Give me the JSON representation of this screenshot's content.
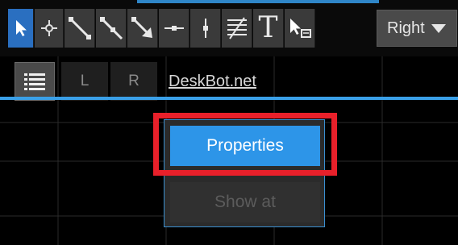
{
  "toolbar": {
    "tools": [
      {
        "name": "pointer-tool",
        "icon": "cursor-arrow-icon",
        "active": true
      },
      {
        "name": "crosshair-tool",
        "icon": "crosshair-icon"
      },
      {
        "name": "trend-line-tool",
        "icon": "trend-line-icon"
      },
      {
        "name": "ray-tool",
        "icon": "ray-icon"
      },
      {
        "name": "arrow-line-tool",
        "icon": "arrow-line-icon"
      },
      {
        "name": "horizontal-line-tool",
        "icon": "horizontal-line-icon"
      },
      {
        "name": "vertical-line-tool",
        "icon": "vertical-line-icon"
      },
      {
        "name": "fibonacci-tool",
        "icon": "fibonacci-lines-icon"
      },
      {
        "name": "text-tool",
        "icon": "text-icon",
        "label": "T"
      },
      {
        "name": "label-tool",
        "icon": "cursor-label-icon"
      }
    ],
    "dropdown": {
      "selected": "Right"
    }
  },
  "row2": {
    "list_icon": "list-icon",
    "left_button": "L",
    "right_button": "R",
    "site_link": "DeskBot.net"
  },
  "context_menu": {
    "items": [
      {
        "label": "Properties",
        "state": "highlighted"
      },
      {
        "label": "Show at",
        "state": "disabled"
      }
    ]
  },
  "colors": {
    "accent": "#2d95e8",
    "highlight": "#e8202a",
    "background": "#000000"
  }
}
